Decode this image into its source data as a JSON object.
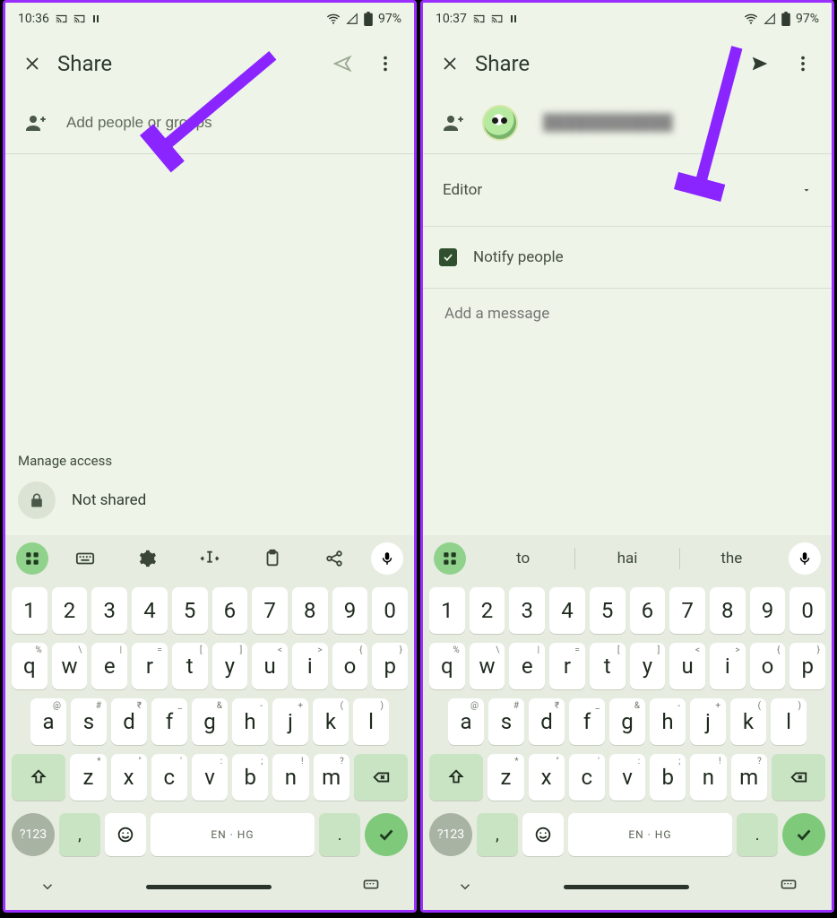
{
  "panes": {
    "left": {
      "status": {
        "time": "10:36",
        "battery": "97%"
      },
      "header": {
        "title": "Share"
      },
      "add_row": {
        "placeholder": "Add people or groups"
      },
      "access": {
        "section_title": "Manage access",
        "state_label": "Not shared"
      }
    },
    "right": {
      "status": {
        "time": "10:37",
        "battery": "97%"
      },
      "header": {
        "title": "Share"
      },
      "role_select": {
        "label": "Editor"
      },
      "notify": {
        "label": "Notify people",
        "checked": true
      },
      "message": {
        "placeholder": "Add a message"
      }
    }
  },
  "keyboard": {
    "toolbar_icons": [
      "apps",
      "keyboard",
      "gear",
      "textselect",
      "clipboard",
      "share",
      "mic"
    ],
    "suggestions": [
      "to",
      "hai",
      "the"
    ],
    "row_numbers": [
      "1",
      "2",
      "3",
      "4",
      "5",
      "6",
      "7",
      "8",
      "9",
      "0"
    ],
    "row_qwerty": [
      {
        "k": "q",
        "h": "%"
      },
      {
        "k": "w",
        "h": "\\"
      },
      {
        "k": "e",
        "h": "|"
      },
      {
        "k": "r",
        "h": "="
      },
      {
        "k": "t",
        "h": "["
      },
      {
        "k": "y",
        "h": "]"
      },
      {
        "k": "u",
        "h": "<"
      },
      {
        "k": "i",
        "h": ">"
      },
      {
        "k": "o",
        "h": "{"
      },
      {
        "k": "p",
        "h": "}"
      }
    ],
    "row_asdf": [
      {
        "k": "a",
        "h": "@"
      },
      {
        "k": "s",
        "h": "#"
      },
      {
        "k": "d",
        "h": "₹"
      },
      {
        "k": "f",
        "h": "_"
      },
      {
        "k": "g",
        "h": "&"
      },
      {
        "k": "h",
        "h": "-"
      },
      {
        "k": "j",
        "h": "+"
      },
      {
        "k": "k",
        "h": "("
      },
      {
        "k": "l",
        "h": ")"
      }
    ],
    "row_zxcv": [
      {
        "k": "z",
        "h": "*"
      },
      {
        "k": "x",
        "h": "\""
      },
      {
        "k": "c",
        "h": "'"
      },
      {
        "k": "v",
        "h": ":"
      },
      {
        "k": "b",
        "h": ";"
      },
      {
        "k": "n",
        "h": "!"
      },
      {
        "k": "m",
        "h": "?"
      }
    ],
    "sym_label": "?123",
    "space_label": "EN · HG"
  },
  "colors": {
    "frame_border": "#9a2fff",
    "bg": "#eff4e8",
    "accent": "#7fc97b",
    "arrow": "#8a25ff"
  }
}
